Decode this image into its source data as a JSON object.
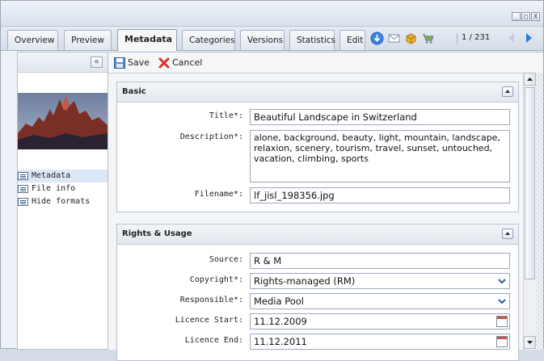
{
  "window": {
    "buttons": [
      "_",
      "□",
      "X"
    ]
  },
  "tabs": [
    {
      "label": "Overview"
    },
    {
      "label": "Preview"
    },
    {
      "label": "Metadata"
    },
    {
      "label": "Categories"
    },
    {
      "label": "Versions"
    },
    {
      "label": "Statistics"
    },
    {
      "label": "Edit"
    }
  ],
  "toolbar_icons": [
    "download-icon",
    "email-icon",
    "package-icon",
    "cart-icon"
  ],
  "pager": {
    "text": "1 / 231"
  },
  "left_panel": {
    "collapse": "«",
    "menu": [
      {
        "label": "Metadata",
        "selected": true
      },
      {
        "label": "File info",
        "selected": false
      },
      {
        "label": "Hide formats",
        "selected": false
      }
    ]
  },
  "actions": {
    "save": "Save",
    "cancel": "Cancel"
  },
  "basic": {
    "title": "Basic",
    "fields": {
      "title_label": "Title*:",
      "title_value": "Beautiful Landscape in Switzerland",
      "description_label": "Description*:",
      "description_value": "alone, background,  beauty, light, mountain, landscape, relaxion, scenery, tourism, travel, sunset, untouched, vacation, climbing, sports",
      "filename_label": "Filename*:",
      "filename_value": "lf_jisl_198356.jpg"
    }
  },
  "rights": {
    "title": "Rights & Usage",
    "fields": {
      "source_label": "Source:",
      "source_value": "R & M",
      "copyright_label": "Copyright*:",
      "copyright_value": "Rights-managed (RM)",
      "responsible_label": "Responsible*:",
      "responsible_value": "Media Pool",
      "licence_start_label": "Licence Start:",
      "licence_start_value": "11.12.2009",
      "licence_end_label": "Licence End:",
      "licence_end_value": "11.12.2011"
    }
  },
  "colors": {
    "accent": "#2e7be0",
    "cancel": "#d9342b"
  }
}
